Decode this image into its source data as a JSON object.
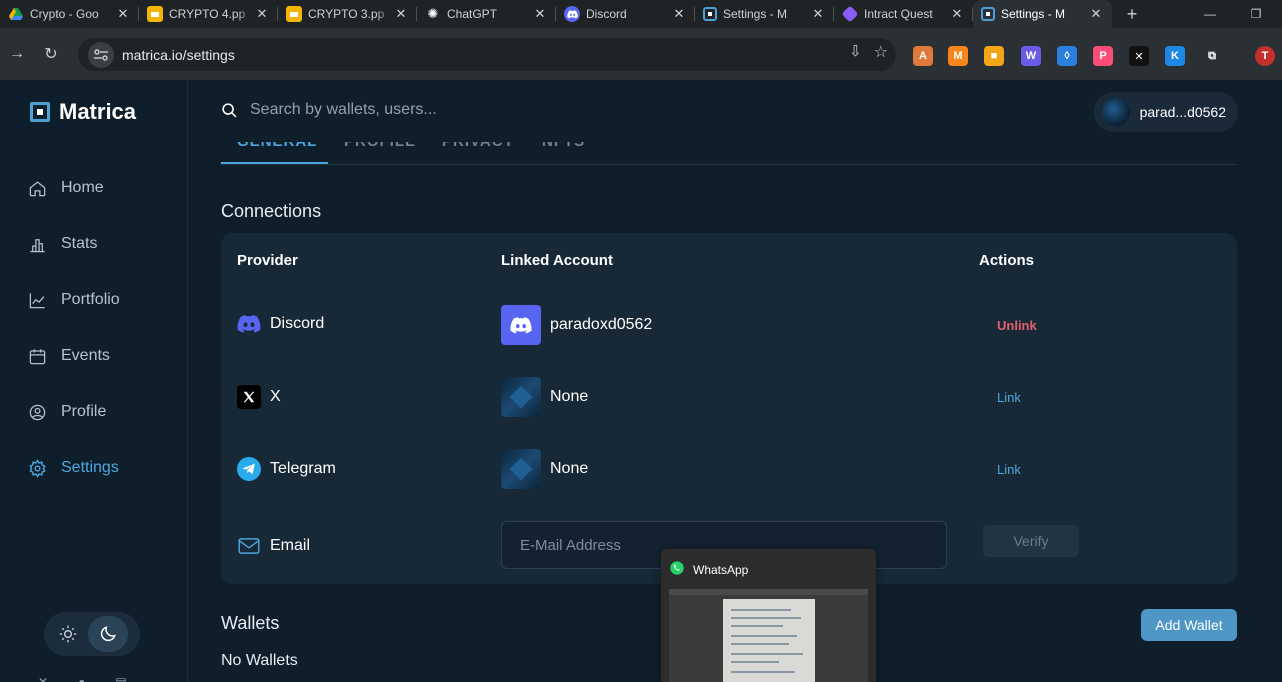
{
  "browser": {
    "tabs": [
      {
        "title": "Crypto - Goo",
        "icon": "google-drive-icon",
        "color": "#1a73e8",
        "active": false
      },
      {
        "title": "CRYPTO 4.pp",
        "icon": "google-slides-icon",
        "color": "#f4b400",
        "active": false
      },
      {
        "title": "CRYPTO 3.pp",
        "icon": "google-slides-icon",
        "color": "#f4b400",
        "active": false
      },
      {
        "title": "ChatGPT",
        "icon": "chatgpt-icon",
        "color": "#ffffff",
        "active": false
      },
      {
        "title": "Discord",
        "icon": "discord-icon",
        "color": "#5865f2",
        "active": false
      },
      {
        "title": "Settings - M",
        "icon": "matrica-icon",
        "color": "#4d9fd4",
        "active": false
      },
      {
        "title": "Intract Quest",
        "icon": "intract-icon",
        "color": "#8b5cf6",
        "active": false
      },
      {
        "title": "Settings - M",
        "icon": "matrica-icon",
        "color": "#4d9fd4",
        "active": true
      }
    ],
    "url": "matrica.io/settings",
    "extensions": [
      {
        "icon": "ext-arc-icon",
        "color": "#e07a3a",
        "glyph": "A"
      },
      {
        "icon": "metamask-icon",
        "color": "#f6851b",
        "glyph": "M"
      },
      {
        "icon": "ext-orange-icon",
        "color": "#f2a516",
        "glyph": "■"
      },
      {
        "icon": "ext-wolf-icon",
        "color": "#6b5ce7",
        "glyph": "W"
      },
      {
        "icon": "ext-drop-icon",
        "color": "#2b7fe0",
        "glyph": "◊"
      },
      {
        "icon": "ext-pink-icon",
        "color": "#ff4d7a",
        "glyph": "P"
      },
      {
        "icon": "ext-x-icon",
        "color": "#111111",
        "glyph": "✕"
      },
      {
        "icon": "ext-k-icon",
        "color": "#1e88e5",
        "glyph": "K"
      },
      {
        "icon": "extensions-puzzle-icon",
        "color": "#2b3034",
        "glyph": "⧉"
      },
      {
        "icon": "profile-avatar-icon",
        "color": "#c4302b",
        "glyph": "T"
      }
    ]
  },
  "app": {
    "logo": "Matrica",
    "nav": [
      {
        "label": "Home",
        "icon": "home-icon",
        "active": false
      },
      {
        "label": "Stats",
        "icon": "stats-icon",
        "active": false
      },
      {
        "label": "Portfolio",
        "icon": "portfolio-icon",
        "active": false
      },
      {
        "label": "Events",
        "icon": "calendar-icon",
        "active": false
      },
      {
        "label": "Profile",
        "icon": "profile-icon",
        "active": false
      },
      {
        "label": "Settings",
        "icon": "gear-icon",
        "active": true
      }
    ],
    "search_placeholder": "Search by wallets, users...",
    "user_chip": "parad...d0562",
    "settings_tabs": [
      "GENERAL",
      "PROFILE",
      "PRIVACY",
      "NFTS"
    ],
    "connections": {
      "title": "Connections",
      "headers": {
        "provider": "Provider",
        "linked": "Linked Account",
        "actions": "Actions"
      },
      "rows": [
        {
          "provider": "Discord",
          "account": "paradoxd0562",
          "action": "Unlink"
        },
        {
          "provider": "X",
          "account": "None",
          "action": "Link"
        },
        {
          "provider": "Telegram",
          "account": "None",
          "action": "Link"
        }
      ],
      "email": {
        "provider": "Email",
        "placeholder": "E-Mail Address",
        "button": "Verify"
      }
    },
    "wallets": {
      "title": "Wallets",
      "empty": "No Wallets",
      "add_button": "Add Wallet"
    }
  },
  "whatsapp_preview": {
    "title": "WhatsApp"
  },
  "colors": {
    "accent": "#4da7de",
    "unlink": "#e5606b",
    "background": "#0f1e2b",
    "card": "#172837"
  }
}
